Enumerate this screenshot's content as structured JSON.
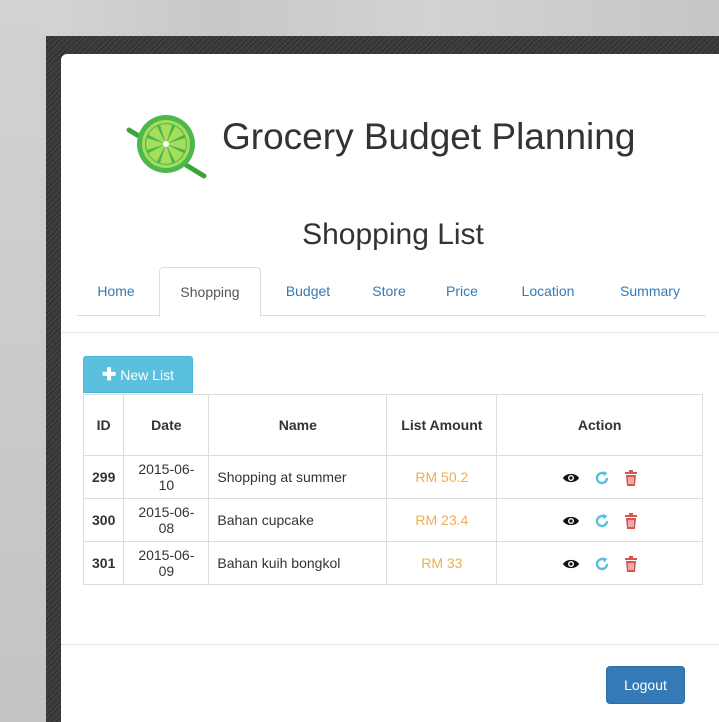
{
  "app": {
    "title": "Grocery Budget Planning",
    "logo_icon": "lime-slice-icon",
    "accent": "#5cb85c"
  },
  "page": {
    "heading": "Shopping List"
  },
  "tabs": [
    {
      "label": "Home",
      "active": false
    },
    {
      "label": "Shopping",
      "active": true
    },
    {
      "label": "Budget",
      "active": false
    },
    {
      "label": "Store",
      "active": false
    },
    {
      "label": "Price",
      "active": false
    },
    {
      "label": "Location",
      "active": false
    },
    {
      "label": "Summary",
      "active": false
    }
  ],
  "toolbar": {
    "new_list_label": "New List",
    "new_list_icon": "plus-icon"
  },
  "table": {
    "columns": [
      "ID",
      "Date",
      "Name",
      "List Amount",
      "Action"
    ],
    "rows": [
      {
        "id": "299",
        "date": "2015-06-10",
        "name": "Shopping at summer",
        "amount": "RM 50.2"
      },
      {
        "id": "300",
        "date": "2015-06-08",
        "name": "Bahan cupcake",
        "amount": "RM 23.4"
      },
      {
        "id": "301",
        "date": "2015-06-09",
        "name": "Bahan kuih bongkol",
        "amount": "RM 33"
      }
    ],
    "action_icons": [
      "eye-icon",
      "refresh-icon",
      "trash-icon"
    ]
  },
  "footer": {
    "logout_label": "Logout"
  },
  "colors": {
    "link": "#337ab7",
    "amount": "#f0ad4e",
    "info_button": "#5bc0de",
    "danger": "#d9534f"
  }
}
